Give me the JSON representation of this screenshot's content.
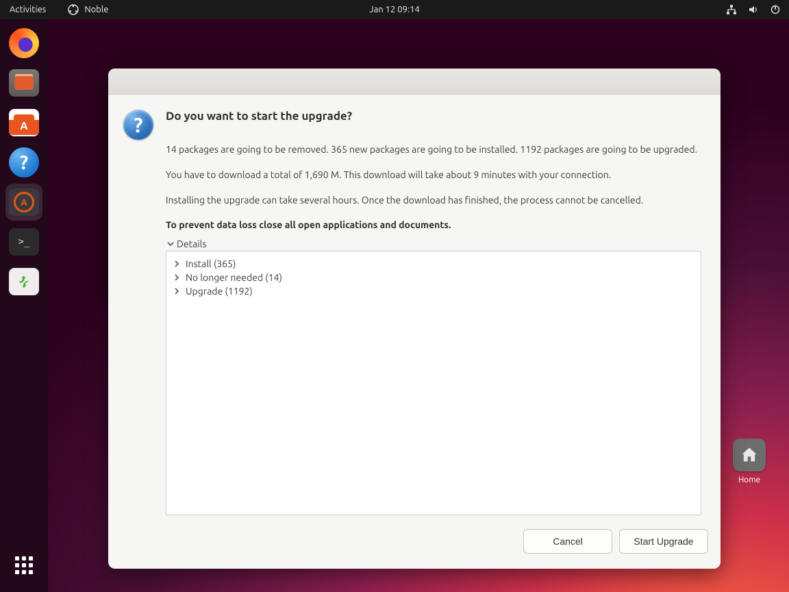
{
  "topbar": {
    "activities": "Activities",
    "app_name": "Noble",
    "clock": "Jan 12  09:14"
  },
  "dock": {
    "items": [
      {
        "name": "firefox",
        "label": "Firefox"
      },
      {
        "name": "files",
        "label": "Files"
      },
      {
        "name": "software",
        "label": "Ubuntu Software"
      },
      {
        "name": "help",
        "label": "Help"
      },
      {
        "name": "software-updater",
        "label": "Software Updater"
      },
      {
        "name": "terminal",
        "label": "Terminal"
      },
      {
        "name": "trash",
        "label": "Trash"
      }
    ]
  },
  "desktop": {
    "home_label": "Home"
  },
  "dialog": {
    "title": "Do you want to start the upgrade?",
    "summary": "14 packages are going to be removed. 365 new packages are going to be installed. 1192 packages are going to be upgraded.",
    "download": "You have to download a total of 1,690 M. This download will take about 9 minutes with your connection.",
    "install_note": "Installing the upgrade can take several hours. Once the download has finished, the process cannot be cancelled.",
    "warn": "To prevent data loss close all open applications and documents.",
    "details_label": "Details",
    "tree": {
      "install": "Install (365)",
      "remove": "No longer needed (14)",
      "upgrade": "Upgrade (1192)"
    },
    "cancel": "Cancel",
    "start": "Start Upgrade"
  }
}
